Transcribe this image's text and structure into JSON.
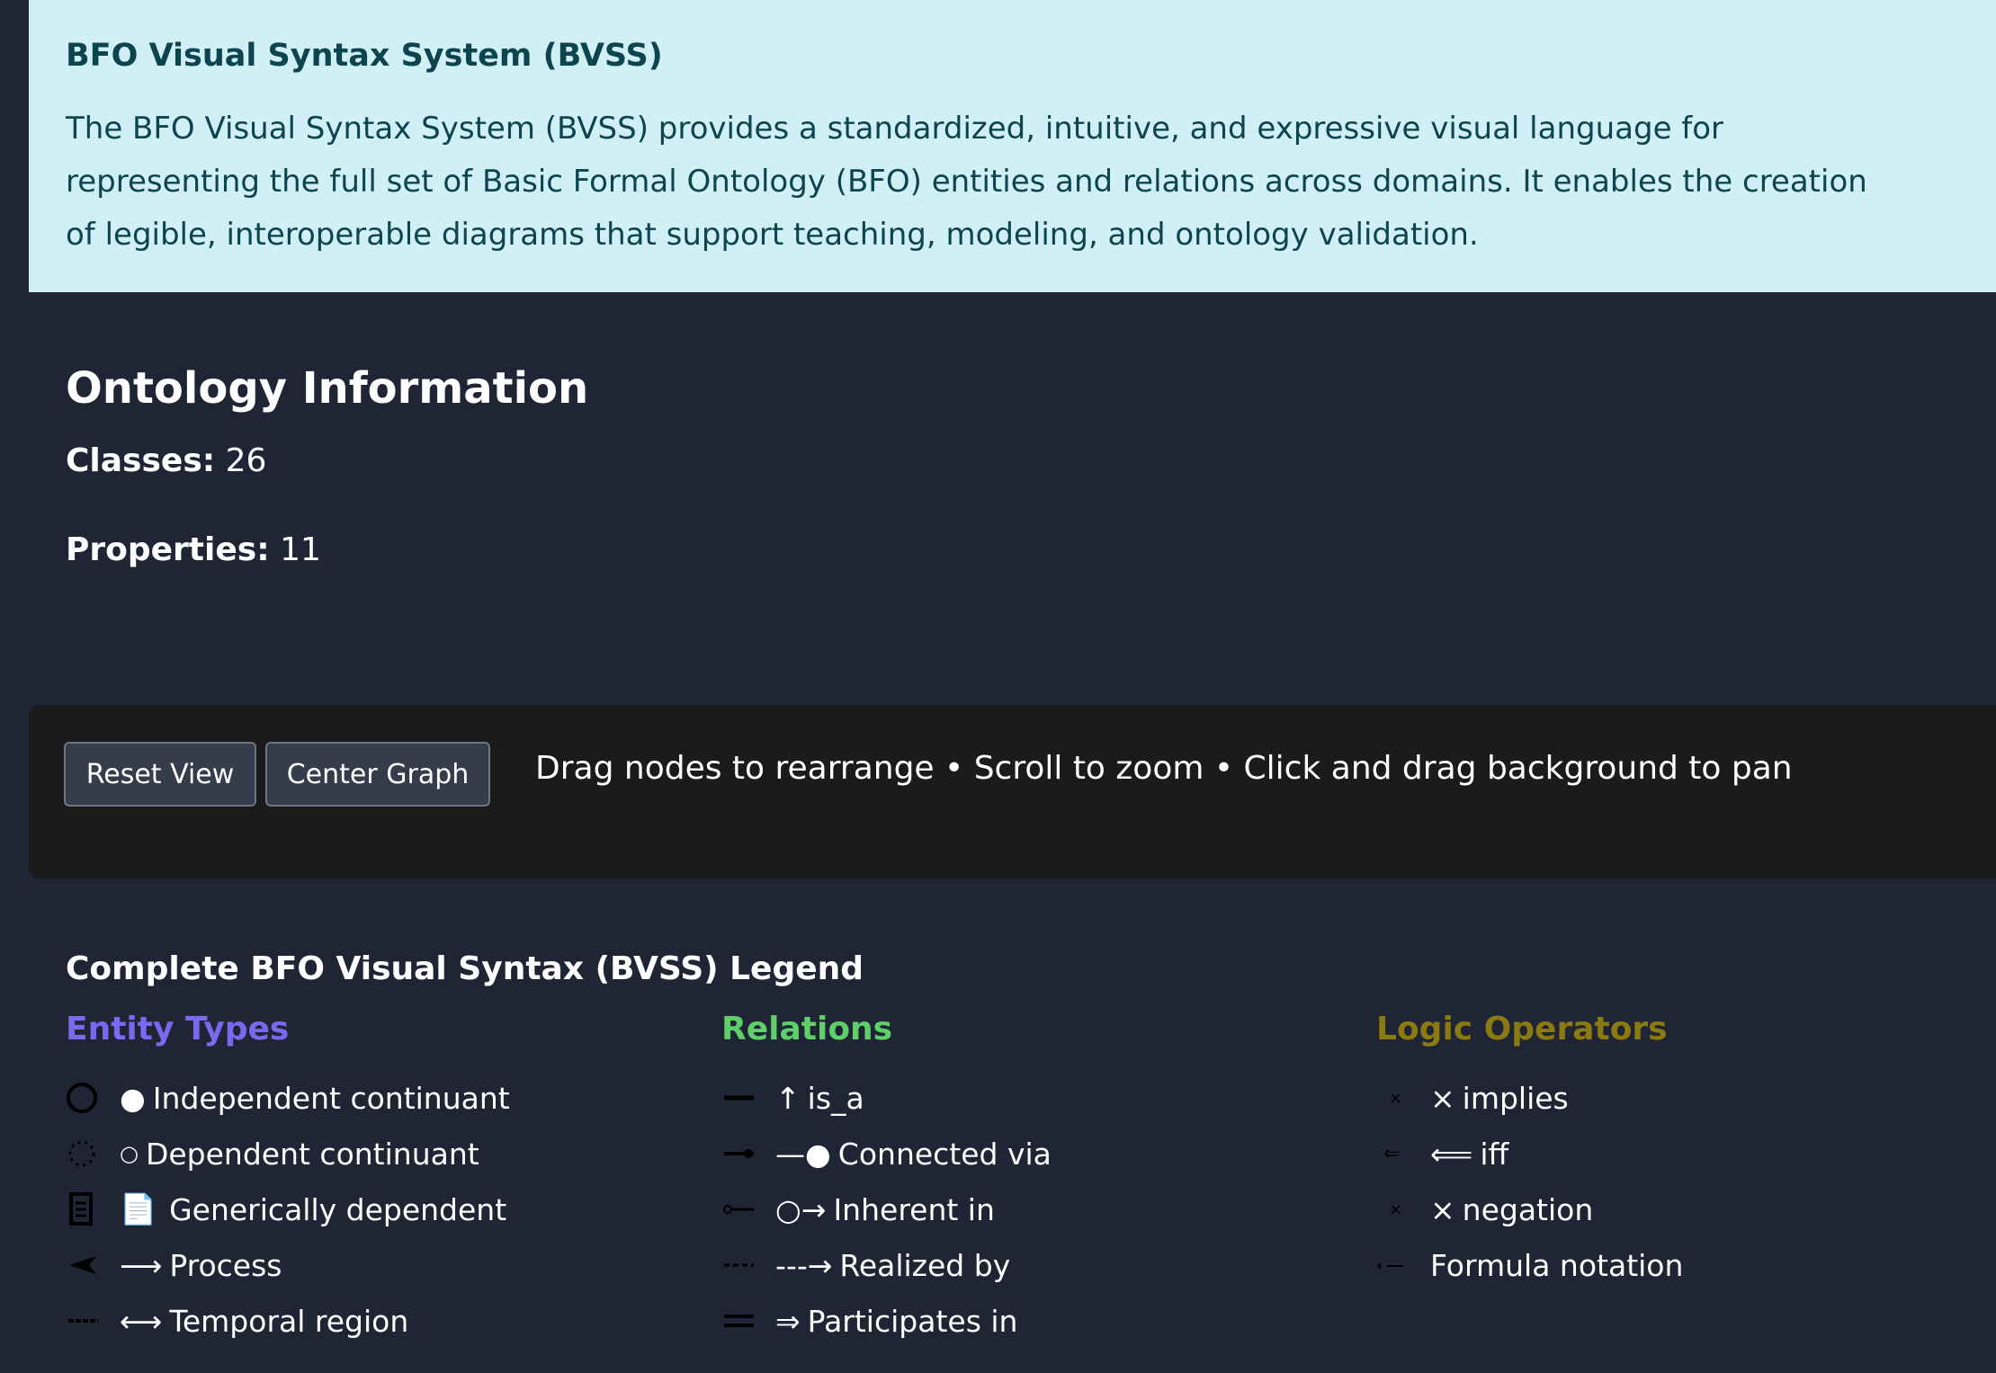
{
  "info": {
    "title": "BFO Visual Syntax System (BVSS)",
    "lines": [
      "The BFO Visual Syntax System (BVSS) provides a standardized, intuitive, and expressive visual language for",
      "representing the full set of Basic Formal Ontology (BFO) entities and relations across domains. It enables the creation",
      "of legible, interoperable diagrams that support teaching, modeling, and ontology validation."
    ]
  },
  "ontology": {
    "title": "Ontology Information",
    "classes_label": "Classes:",
    "classes_value": "26",
    "properties_label": "Properties:",
    "properties_value": "11"
  },
  "toolbar": {
    "reset_label": "Reset View",
    "center_label": "Center Graph",
    "hint": "Drag nodes to rearrange • Scroll to zoom • Click and drag background to pan"
  },
  "legend": {
    "title": "Complete BFO Visual Syntax (BVSS) Legend",
    "entity_title": "Entity Types",
    "relations_title": "Relations",
    "logic_title": "Logic Operators",
    "colors": {
      "entity": "#7b68ee",
      "relations": "#5fcf6a",
      "logic": "#8b7a12"
    },
    "entities": [
      {
        "glyph": "●",
        "label": "Independent continuant",
        "icon": "solid-circle-icon"
      },
      {
        "glyph": "○",
        "label": "Dependent continuant",
        "icon": "dotted-circle-icon"
      },
      {
        "glyph": "📄",
        "label": "Generically dependent",
        "icon": "document-icon"
      },
      {
        "glyph": "⟶",
        "label": "Process",
        "icon": "arrowhead-icon"
      },
      {
        "glyph": "⟷",
        "label": "Temporal region",
        "icon": "dashed-line-icon"
      }
    ],
    "relations": [
      {
        "glyph": "↑",
        "label": "is_a",
        "icon": "thick-line-icon"
      },
      {
        "glyph": "—●",
        "label": "Connected via",
        "icon": "line-dot-icon"
      },
      {
        "glyph": "○→",
        "label": "Inherent in",
        "icon": "circle-line-icon"
      },
      {
        "glyph": "---→",
        "label": "Realized by",
        "icon": "dashed-line-icon"
      },
      {
        "glyph": "⇒",
        "label": "Participates in",
        "icon": "double-line-icon"
      }
    ],
    "logic": [
      {
        "glyph": "×",
        "label": "implies",
        "icon": "cross-icon"
      },
      {
        "glyph": "⟸",
        "label": "iff",
        "icon": "left-double-arrow-icon"
      },
      {
        "glyph": "×",
        "label": "negation",
        "icon": "cross-icon"
      },
      {
        "glyph": "",
        "label": "Formula notation",
        "icon": "formula-line-icon"
      }
    ]
  }
}
